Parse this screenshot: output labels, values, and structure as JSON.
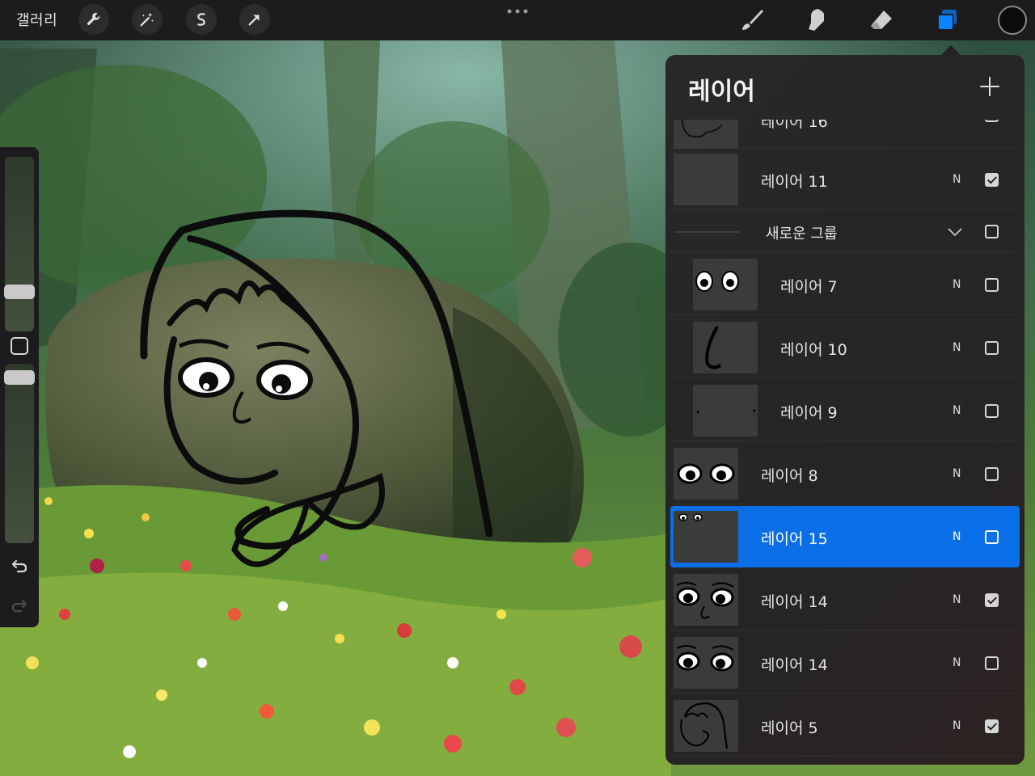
{
  "topbar": {
    "gallery_label": "갤러리",
    "actions": [
      {
        "name": "actions-button",
        "icon": "wrench-icon"
      },
      {
        "name": "adjustments-button",
        "icon": "magic-wand-icon"
      },
      {
        "name": "selection-button",
        "icon": "s-curve-icon"
      },
      {
        "name": "transform-button",
        "icon": "arrow-cursor-icon"
      }
    ],
    "tools": [
      {
        "name": "brush-tool",
        "icon": "brush-icon"
      },
      {
        "name": "smudge-tool",
        "icon": "smudge-icon"
      },
      {
        "name": "eraser-tool",
        "icon": "eraser-icon"
      },
      {
        "name": "layers-tool",
        "icon": "layers-icon",
        "active": true
      }
    ],
    "active_color": "#0b0b0b",
    "accent_color": "#0a84ff"
  },
  "sidebar": {
    "brush_size": 0.2,
    "opacity": 0.96,
    "icons": [
      "modify-square-icon",
      "undo-icon",
      "redo-icon"
    ]
  },
  "layers": {
    "title": "레이어",
    "partial_top": {
      "name": "레이어 16",
      "blend": "N",
      "visible": false
    },
    "rows": [
      {
        "kind": "layer",
        "name": "레이어 11",
        "blend": "N",
        "visible": true,
        "thumb": "blank"
      },
      {
        "kind": "group",
        "name": "새로운 그룹",
        "visible": false
      },
      {
        "kind": "child",
        "name": "레이어 7",
        "blend": "N",
        "visible": false,
        "thumb": "eyes-small"
      },
      {
        "kind": "child",
        "name": "레이어 10",
        "blend": "N",
        "visible": false,
        "thumb": "nose"
      },
      {
        "kind": "child",
        "name": "레이어 9",
        "blend": "N",
        "visible": false,
        "thumb": "dots"
      },
      {
        "kind": "layer",
        "name": "레이어 8",
        "blend": "N",
        "visible": false,
        "thumb": "eyes"
      },
      {
        "kind": "layer",
        "name": "레이어 15",
        "blend": "N",
        "visible": false,
        "thumb": "eyes-tiny",
        "selected": true
      },
      {
        "kind": "layer",
        "name": "레이어 14",
        "blend": "N",
        "visible": true,
        "thumb": "face"
      },
      {
        "kind": "layer",
        "name": "레이어 14",
        "blend": "N",
        "visible": false,
        "thumb": "face"
      },
      {
        "kind": "layer",
        "name": "레이어 5",
        "blend": "N",
        "visible": true,
        "thumb": "head"
      }
    ]
  }
}
